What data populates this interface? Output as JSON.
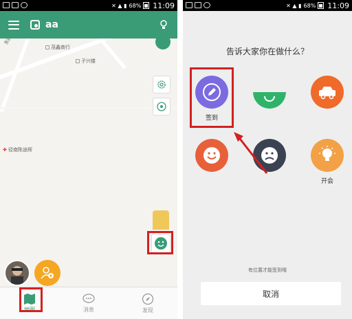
{
  "left_screen": {
    "status": {
      "battery": "68%",
      "time": "11:09"
    },
    "app_title": "aa",
    "map_labels": [
      "茂鑫商行",
      "子兴楼",
      "径南陈途辉",
      "东四江路"
    ],
    "nav": [
      {
        "label": "地图",
        "icon": "map-icon"
      },
      {
        "label": "消息",
        "icon": "message-icon"
      },
      {
        "label": "发现",
        "icon": "compass-icon"
      }
    ],
    "colors": {
      "primary": "#3a9b77",
      "highlight": "#d32020",
      "accent": "#f5a623"
    }
  },
  "right_screen": {
    "status": {
      "battery": "68%",
      "time": "11:09"
    },
    "prompt": "告诉大家你在做什么？",
    "activities": [
      {
        "label": "签到",
        "icon": "pencil-icon",
        "color": "#7b6be0"
      },
      {
        "label": "",
        "icon": "green-face-icon",
        "color": "#2fb36a"
      },
      {
        "label": "",
        "icon": "car-icon",
        "color": "#f06a2a"
      },
      {
        "label": "",
        "icon": "happy-face-icon",
        "color": "#e8603a"
      },
      {
        "label": "",
        "icon": "sad-face-icon",
        "color": "#3b4251"
      },
      {
        "label": "开会",
        "icon": "bulb-icon",
        "color": "#f3a146"
      }
    ],
    "hint": "有位置才能签到哦",
    "cancel_label": "取消"
  }
}
